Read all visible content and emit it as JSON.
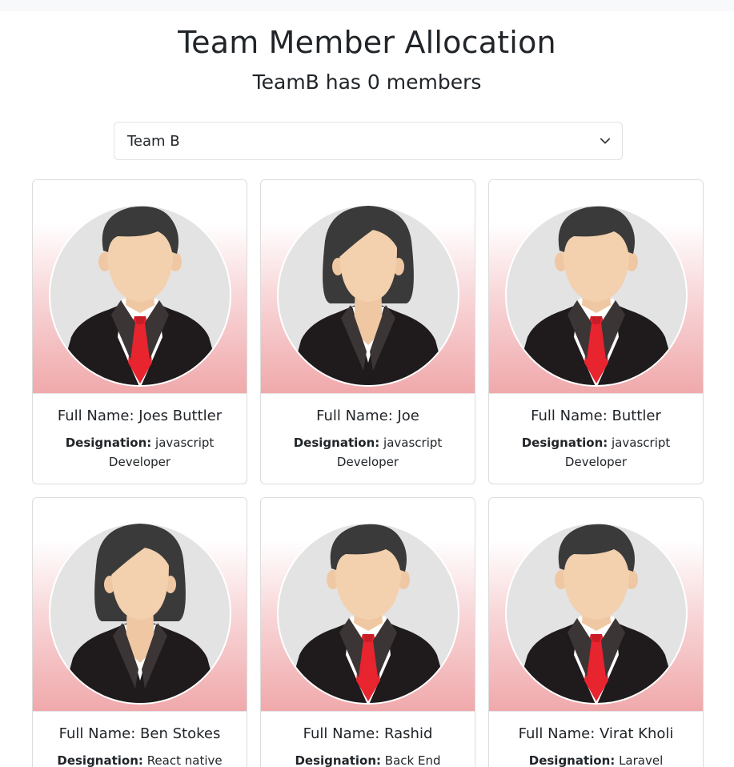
{
  "header": {
    "title": "Team Member Allocation",
    "subtitle": "TeamB has 0 members"
  },
  "team_select": {
    "selected": "Team B"
  },
  "labels": {
    "full_name_prefix": "Full Name: ",
    "designation_label": "Designation:"
  },
  "employees": [
    {
      "full_name": "Joes Buttler",
      "designation": "javascript Developer",
      "gender": "male"
    },
    {
      "full_name": "Joe",
      "designation": "javascript Developer",
      "gender": "female"
    },
    {
      "full_name": "Buttler",
      "designation": "javascript Developer",
      "gender": "male"
    },
    {
      "full_name": "Ben Stokes",
      "designation": "React native",
      "gender": "female"
    },
    {
      "full_name": "Rashid",
      "designation": "Back End",
      "gender": "male"
    },
    {
      "full_name": "Virat Kholi",
      "designation": "Laravel Developer",
      "gender": "male"
    }
  ],
  "colors": {
    "card_gradient_bottom": "#f0a9ab",
    "tie": "#e8242f",
    "suit": "#1f1b1c",
    "hair": "#3a3a3a",
    "skin": "#f2cfac"
  }
}
